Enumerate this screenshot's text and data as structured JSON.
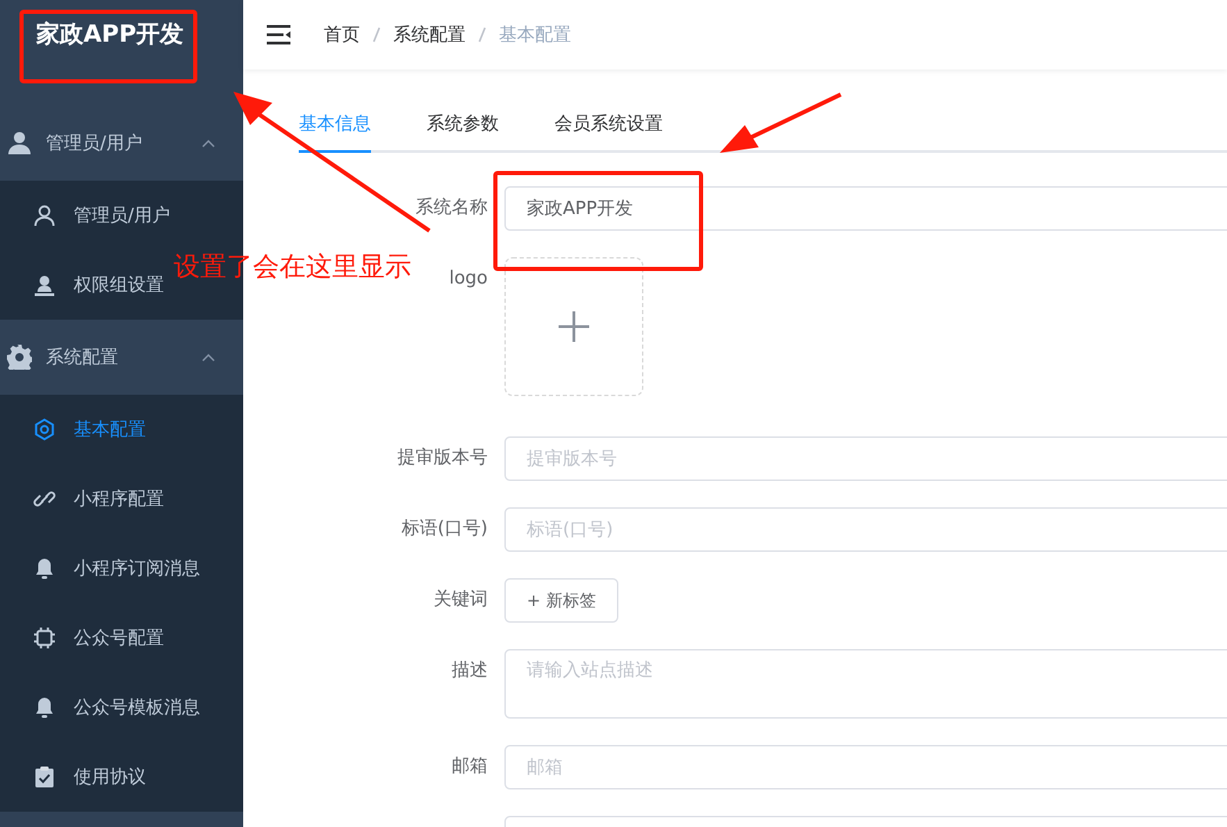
{
  "sidebar": {
    "title": "家政APP开发",
    "items": [
      {
        "kind": "group",
        "label": "管理员/用户",
        "expanded": true,
        "selected": false
      },
      {
        "kind": "item",
        "label": "管理员/用户",
        "selected": false
      },
      {
        "kind": "item",
        "label": "权限组设置",
        "selected": false
      },
      {
        "kind": "group",
        "label": "系统配置",
        "expanded": true,
        "selected": false
      },
      {
        "kind": "item",
        "label": "基本配置",
        "selected": true
      },
      {
        "kind": "item",
        "label": "小程序配置",
        "selected": false
      },
      {
        "kind": "item",
        "label": "小程序订阅消息",
        "selected": false
      },
      {
        "kind": "item",
        "label": "公众号配置",
        "selected": false
      },
      {
        "kind": "item",
        "label": "公众号模板消息",
        "selected": false
      },
      {
        "kind": "item",
        "label": "使用协议",
        "selected": false
      }
    ]
  },
  "breadcrumb": [
    "首页",
    "系统配置",
    "基本配置"
  ],
  "tabs": [
    {
      "label": "基本信息",
      "selected": true
    },
    {
      "label": "系统参数",
      "selected": false
    },
    {
      "label": "会员系统设置",
      "selected": false
    }
  ],
  "form": [
    {
      "kind": "input",
      "label": "系统名称",
      "value": "家政APP开发"
    },
    {
      "kind": "upload",
      "label": "logo"
    },
    {
      "kind": "input",
      "label": "提审版本号",
      "placeholder": "提审版本号"
    },
    {
      "kind": "input",
      "label": "标语(口号)",
      "placeholder": "标语(口号)"
    },
    {
      "kind": "tags",
      "label": "关键词",
      "button": "+ 新标签"
    },
    {
      "kind": "textarea",
      "label": "描述",
      "placeholder": "请输入站点描述"
    },
    {
      "kind": "input",
      "label": "邮箱",
      "placeholder": "邮箱"
    },
    {
      "kind": "input"
    }
  ],
  "annotation": {
    "note": "设置了会在这里显示"
  }
}
